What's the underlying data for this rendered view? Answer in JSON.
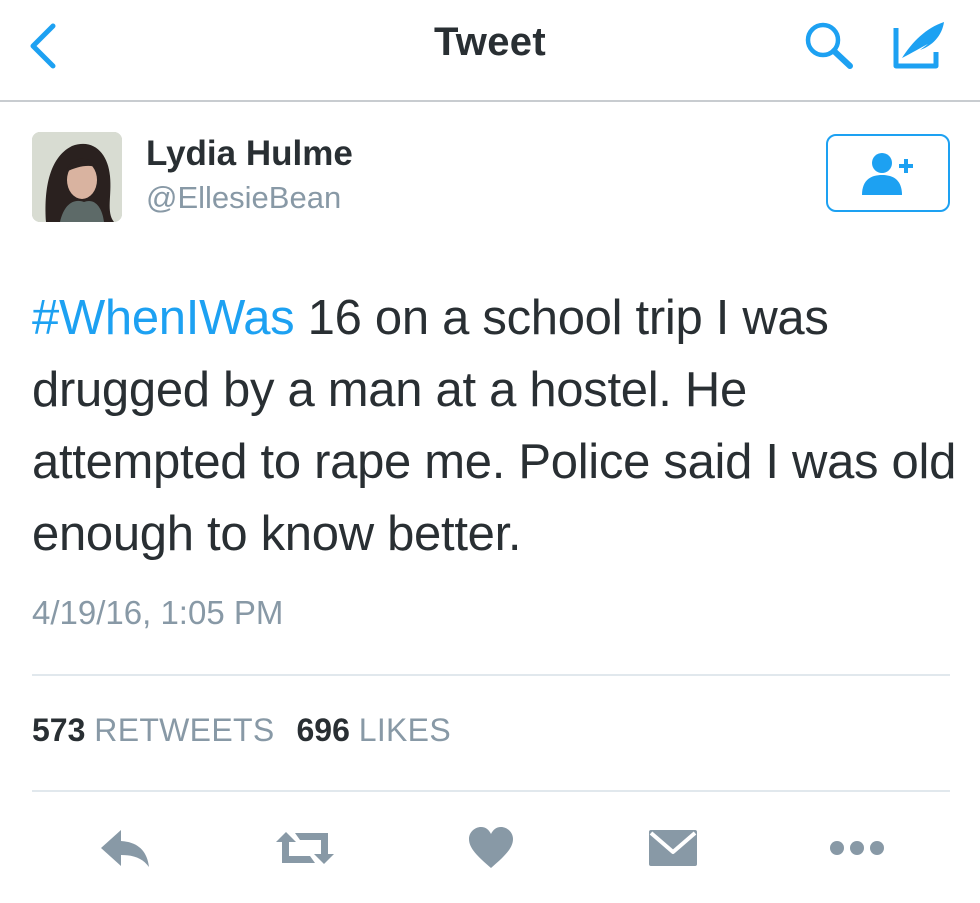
{
  "nav": {
    "title": "Tweet",
    "back_icon": "chevron-left-icon",
    "search_icon": "search-icon",
    "compose_icon": "compose-icon"
  },
  "author": {
    "name": "Lydia Hulme",
    "handle": "@EllesieBean",
    "avatar_icon": "profile-photo",
    "follow_icon": "add-user-icon"
  },
  "tweet": {
    "hashtag": "#WhenIWas",
    "text": " 16 on a school trip I was drugged by a man at a hostel. He attempted to rape me. Police said I was old enough to know better.",
    "timestamp": "4/19/16, 1:05 PM"
  },
  "stats": {
    "retweets_count": "573",
    "retweets_label": "RETWEETS",
    "likes_count": "696",
    "likes_label": "LIKES"
  },
  "actions": {
    "reply_icon": "reply-icon",
    "retweet_icon": "retweet-icon",
    "like_icon": "heart-icon",
    "dm_icon": "envelope-icon",
    "more_icon": "more-icon"
  },
  "colors": {
    "accent": "#1da1f2",
    "text": "#292f33",
    "secondary": "#8899a6",
    "icon": "#8899a6",
    "divider": "#e1e8ed"
  }
}
